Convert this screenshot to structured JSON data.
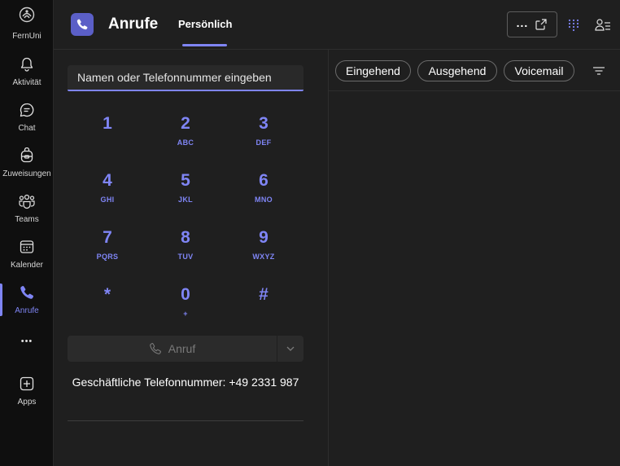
{
  "rail": {
    "logo_label": "FernUni",
    "items": [
      {
        "label": "Aktivität",
        "icon": "bell-icon"
      },
      {
        "label": "Chat",
        "icon": "chat-icon"
      },
      {
        "label": "Zuweisungen",
        "icon": "backpack-icon"
      },
      {
        "label": "Teams",
        "icon": "teams-icon"
      },
      {
        "label": "Kalender",
        "icon": "calendar-icon"
      },
      {
        "label": "Anrufe",
        "icon": "phone-icon",
        "active": true
      }
    ],
    "more_label": "•••",
    "apps_label": "Apps"
  },
  "header": {
    "title": "Anrufe",
    "tab_label": "Persönlich",
    "popout_label": "..."
  },
  "dialpad": {
    "search_placeholder": "Namen oder Telefonnummer eingeben",
    "keys": [
      {
        "digit": "1",
        "letters": ""
      },
      {
        "digit": "2",
        "letters": "ABC"
      },
      {
        "digit": "3",
        "letters": "DEF"
      },
      {
        "digit": "4",
        "letters": "GHI"
      },
      {
        "digit": "5",
        "letters": "JKL"
      },
      {
        "digit": "6",
        "letters": "MNO"
      },
      {
        "digit": "7",
        "letters": "PQRS"
      },
      {
        "digit": "8",
        "letters": "TUV"
      },
      {
        "digit": "9",
        "letters": "WXYZ"
      },
      {
        "digit": "*",
        "letters": ""
      },
      {
        "digit": "0",
        "letters": "+"
      },
      {
        "digit": "#",
        "letters": ""
      }
    ],
    "call_label": "Anruf",
    "business_number": "Geschäftliche Telefonnummer: +49 2331 987"
  },
  "history": {
    "filters": [
      "Eingehend",
      "Ausgehend",
      "Voicemail"
    ]
  },
  "colors": {
    "accent": "#7f85f5",
    "brand": "#5b5fc7",
    "background": "#1f1f1f",
    "rail": "#0f0f0f"
  }
}
